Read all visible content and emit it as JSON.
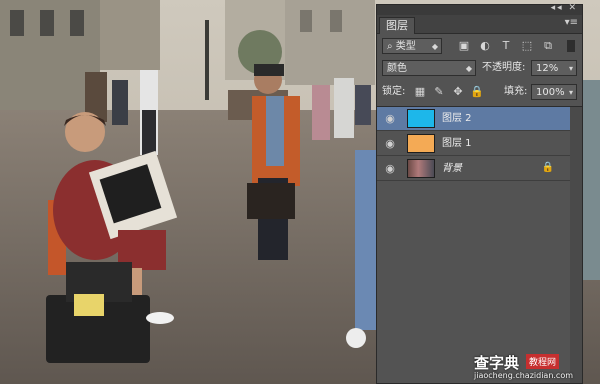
{
  "panel": {
    "tab_label": "图层",
    "filter": {
      "label": "类型",
      "icons": [
        "pixel-filter-icon",
        "adjustment-filter-icon",
        "type-filter-icon",
        "shape-filter-icon",
        "smart-object-filter-icon"
      ]
    },
    "blend_mode": "颜色",
    "opacity_label": "不透明度:",
    "opacity_value": "12%",
    "lock_label": "锁定:",
    "fill_label": "填充:",
    "fill_value": "100%",
    "layers": [
      {
        "name": "图层 2",
        "selected": true,
        "thumb_color": "#1db7ea",
        "visible": true
      },
      {
        "name": "图层 1",
        "selected": false,
        "thumb_color": "#f4aa55",
        "visible": true
      },
      {
        "name": "背景",
        "selected": false,
        "thumb": "photo",
        "locked": true,
        "visible": true,
        "italic": true
      }
    ]
  },
  "watermark": {
    "main": "查字典",
    "badge": "教程网",
    "url": "jiaocheng.chazidian.com"
  }
}
